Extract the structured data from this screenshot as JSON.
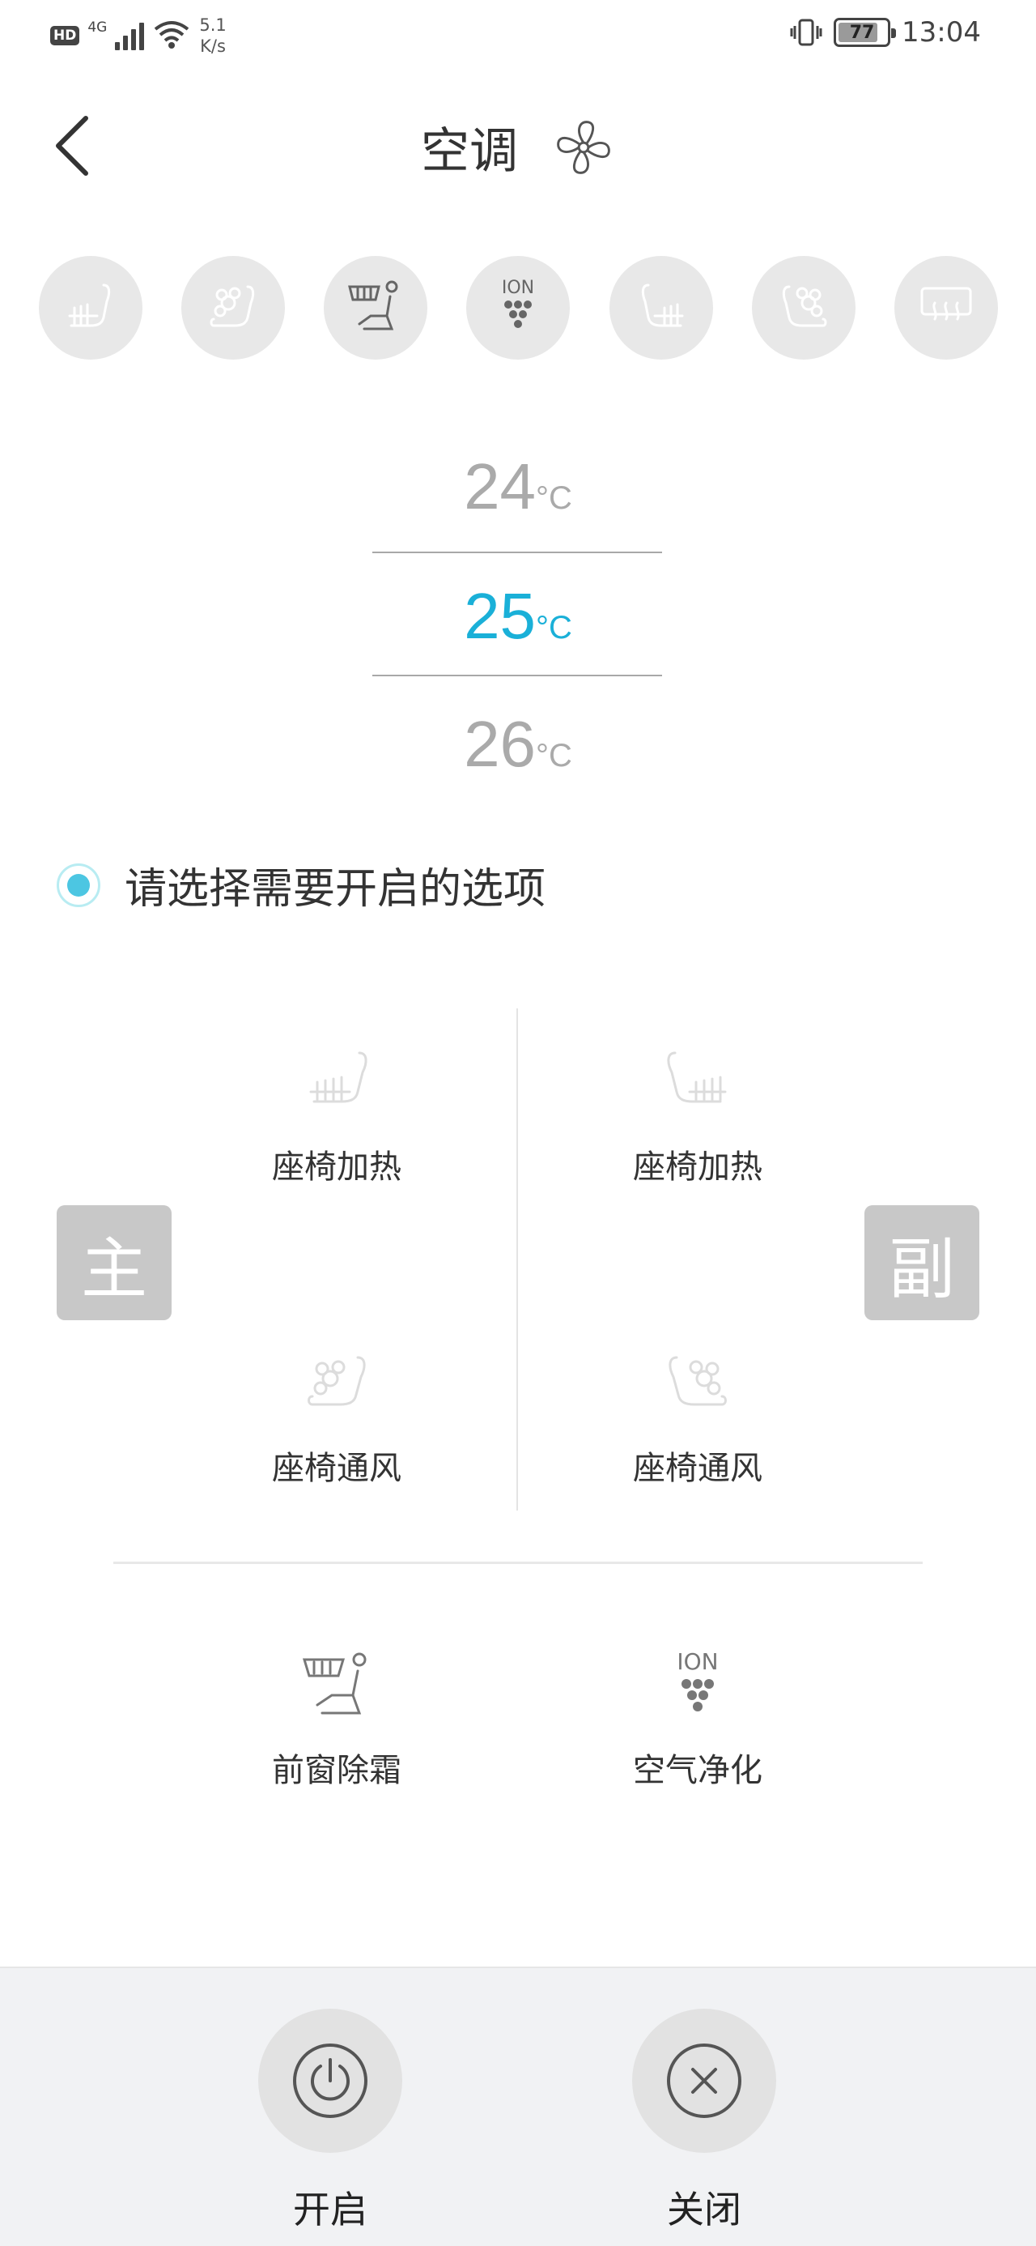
{
  "status_bar": {
    "hd": "HD",
    "network": "4G",
    "speed_value": "5.1",
    "speed_unit": "K/s",
    "battery": "77",
    "time": "13:04",
    "icons": [
      "signal-icon",
      "wifi-icon",
      "vibrate-icon",
      "battery-icon"
    ]
  },
  "header": {
    "title": "空调",
    "icons": [
      "back-icon",
      "fan-icon"
    ]
  },
  "quick_actions": [
    {
      "name": "seat-heat-driver-icon",
      "active": false
    },
    {
      "name": "seat-vent-driver-icon",
      "active": false
    },
    {
      "name": "front-defrost-icon",
      "active": true
    },
    {
      "name": "ion-purify-icon",
      "active": true,
      "label": "ION"
    },
    {
      "name": "seat-heat-passenger-icon",
      "active": false
    },
    {
      "name": "seat-vent-passenger-icon",
      "active": false
    },
    {
      "name": "rear-defrost-icon",
      "active": false
    }
  ],
  "temperature": {
    "prev": "24",
    "current": "25",
    "next": "26",
    "unit": "°C"
  },
  "hint": {
    "text": "请选择需要开启的选项"
  },
  "seats": {
    "main_badge": "主",
    "sub_badge": "副",
    "driver_heat": "座椅加热",
    "passenger_heat": "座椅加热",
    "driver_vent": "座椅通风",
    "passenger_vent": "座椅通风"
  },
  "options": {
    "front_defrost": "前窗除霜",
    "air_purify": "空气净化",
    "ion_label": "ION"
  },
  "actions": {
    "on_label": "开启",
    "off_label": "关闭"
  },
  "colors": {
    "accent": "#1ab0d8",
    "inactive_icon": "#d8d8d8",
    "active_icon": "#666666",
    "badge_bg": "#c8c8c8"
  }
}
